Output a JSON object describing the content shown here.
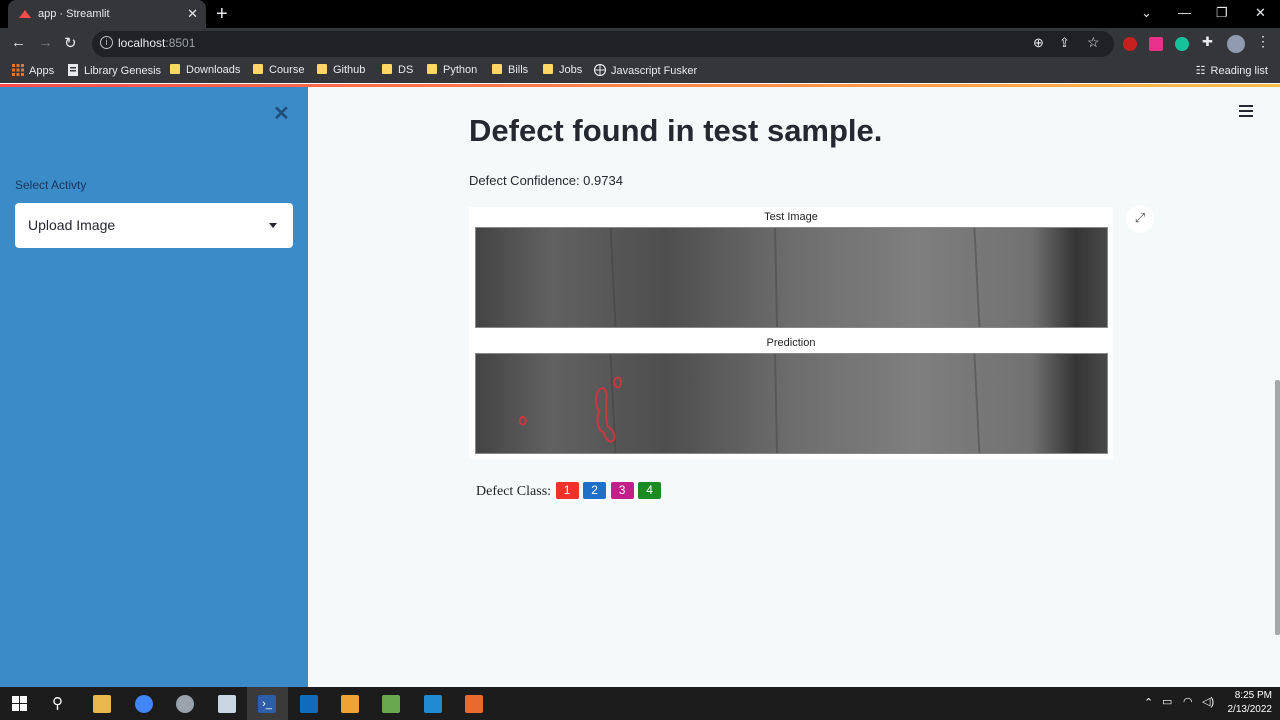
{
  "browser": {
    "tab_title": "app · Streamlit",
    "url_host": "localhost",
    "url_port": ":8501",
    "bookmarks": [
      "Apps",
      "Library Genesis",
      "Downloads",
      "Course",
      "Github",
      "DS",
      "Python",
      "Bills",
      "Jobs",
      "Javascript Fusker"
    ],
    "reading_list": "Reading list"
  },
  "sidebar": {
    "label": "Select Activty",
    "selected": "Upload Image"
  },
  "main": {
    "heading": "Defect found in test sample.",
    "confidence": "Defect Confidence: 0.9734",
    "figure": {
      "top_title": "Test Image",
      "bottom_title": "Prediction"
    },
    "defect_class_label": "Defect Class:",
    "classes": [
      {
        "label": "1",
        "color": "#f0302a"
      },
      {
        "label": "2",
        "color": "#1e6fc8"
      },
      {
        "label": "3",
        "color": "#c21f8b"
      },
      {
        "label": "4",
        "color": "#1a8a24"
      }
    ]
  },
  "taskbar": {
    "time": "8:25 PM",
    "date": "2/13/2022"
  }
}
